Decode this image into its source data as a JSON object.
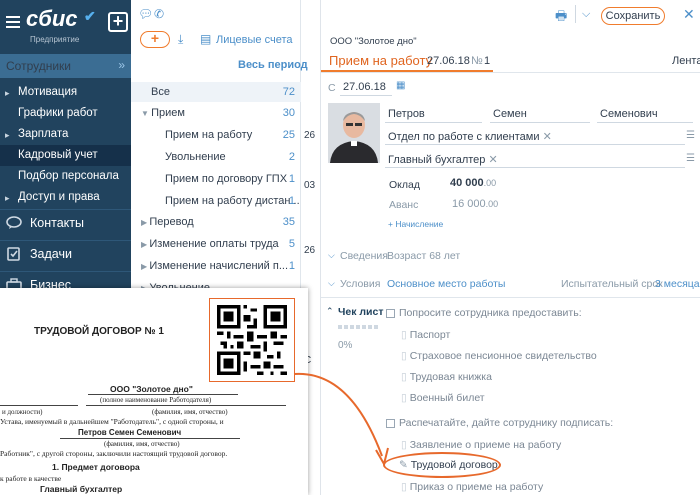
{
  "app": {
    "logo": "сбис",
    "logo_sub": "Предприятие"
  },
  "sidebar": {
    "section": "Сотрудники",
    "items": [
      {
        "label": "Мотивация"
      },
      {
        "label": "Графики работ"
      },
      {
        "label": "Зарплата"
      },
      {
        "label": "Кадровый учет"
      },
      {
        "label": "Подбор персонала"
      },
      {
        "label": "Доступ и права"
      }
    ],
    "big_items": [
      {
        "label": "Контакты"
      },
      {
        "label": "Задачи"
      },
      {
        "label": "Бизнес"
      }
    ]
  },
  "list": {
    "accounts_label": "Лицевые счета",
    "period": "Весь период",
    "rows": [
      {
        "label": "Все",
        "count": "72"
      },
      {
        "label": "Прием",
        "count": "30"
      },
      {
        "label": "Прием на работу",
        "count": "25"
      },
      {
        "label": "Увольнение",
        "count": "2"
      },
      {
        "label": "Прием по договору ГПХ",
        "count": "1"
      },
      {
        "label": "Прием на работу дистан...",
        "count": "1"
      },
      {
        "label": "Перевод",
        "count": "35"
      },
      {
        "label": "Изменение оплаты труда",
        "count": "5"
      },
      {
        "label": "Изменение начислений п...",
        "count": "1"
      },
      {
        "label": "Увольнение",
        "count": ""
      }
    ],
    "partial_col": [
      "26",
      "03",
      "26",
      "С"
    ]
  },
  "doc": {
    "org": "ООО \"Золотое дно\"",
    "title": "Прием на работу",
    "date": "27.06.18",
    "number_label": "№",
    "number": "1",
    "feed": "Лента",
    "save": "Сохранить",
    "from_label": "С",
    "from_date": "27.06.18",
    "last_name": "Петров",
    "first_name": "Семен",
    "middle_name": "Семенович",
    "department": "Отдел по работе с клиентами",
    "position": "Главный бухгалтер",
    "salary_label": "Оклад",
    "salary": "40 000",
    "salary_dec": ".00",
    "advance_label": "Аванс",
    "advance": "16 000",
    "advance_dec": ".00",
    "accrual": "+ Начисление",
    "info_label": "Сведения",
    "info_value": "Возраст 68 лет",
    "cond_label": "Условия",
    "cond_value": "Основное место работы",
    "probation_label": "Испытательный срок",
    "probation_value": "3 месяца",
    "checklist_label": "Чек лист",
    "checklist_progress": "0%",
    "ask_label": "Попросите сотрудника предоставить:",
    "ask_items": [
      "Паспорт",
      "Страховое пенсионное свидетельство",
      "Трудовая книжка",
      "Военный билет"
    ],
    "print_label": "Распечатайте, дайте сотруднику подписать:",
    "print_items": [
      "Заявление о приеме на работу",
      "Трудовой договор",
      "Приказ о приеме на работу"
    ]
  },
  "contract": {
    "title": "ТРУДОВОЙ ДОГОВОР № 1",
    "org": "ООО \"Золотое дно\"",
    "org_note": "(полное наименование Работодателя)",
    "line1_left": "и должности)",
    "line1_right": "(фамилия, имя, отчество)",
    "line2": "Устава, именуемый в дальнейшем \"Работодатель\", с одной стороны, и",
    "employee": "Петров Семен Семенович",
    "employee_note": "(фамилия, имя, отчество)",
    "line3": "Работник\", с другой стороны, заключили настоящий трудовой договор.",
    "section1": "1. Предмет договора",
    "line4": "к работе в качестве",
    "position": "Главный бухгалтер"
  },
  "colors": {
    "accent": "#f07c2d",
    "sidebar": "#21435e",
    "link": "#4c8fc9"
  }
}
